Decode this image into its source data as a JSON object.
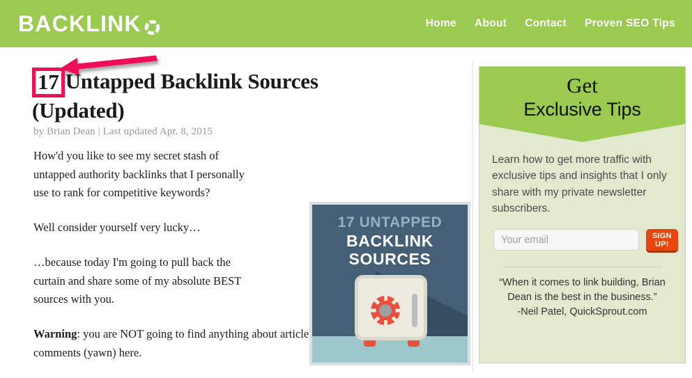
{
  "header": {
    "logo_text": "BACKLINK",
    "logo_icon": "dashed-circle-o",
    "nav": [
      {
        "label": "Home"
      },
      {
        "label": "About"
      },
      {
        "label": "Contact"
      },
      {
        "label": "Proven SEO Tips"
      }
    ],
    "background_color": "#9ACA4F"
  },
  "annotation": {
    "arrow_color": "#EE1158",
    "highlight_box_color": "#EE1158",
    "highlight_target": "17"
  },
  "article": {
    "title_badge": "17",
    "title_rest": "Untapped Backlink Sources (Updated)",
    "meta": "by Brian Dean | Last updated Apr. 8, 2015",
    "paragraphs": [
      "How'd you like to see my secret stash of untapped authority backlinks that I personally use to rank for competitive keywords?",
      "Well consider yourself very lucky…",
      "…because today I'm going to pull back the curtain and share some of my absolute BEST sources with you."
    ],
    "warning_label": "Warning",
    "warning_text": ": you are NOT going to find anything about article directories (blah) or blog comments (yawn) here."
  },
  "featured_image": {
    "line1": "17 UNTAPPED",
    "line2a": "BACKLINK",
    "line2b": "SOURCES",
    "background_color": "#456076",
    "accent_color": "#8FB6BE",
    "floor_color": "#9CC7CB",
    "safe_color": "#EDEAE0",
    "dial_color": "#E8503C"
  },
  "sidebar": {
    "title_line1": "Get",
    "title_line2": "Exclusive Tips",
    "description": "Learn how to get more traffic with exclusive tips and insights that I only share with my private newsletter subscribers.",
    "email_placeholder": "Your email",
    "email_value": "",
    "signup_label": "SIGN UP!",
    "testimonial_line1": "“When it comes to link building, Brian",
    "testimonial_line2": "Dean is the best in the business.”",
    "testimonial_line3": "-Neil Patel, QuickSprout.com",
    "header_color": "#9ACA4F",
    "body_color": "#E3E9CF",
    "button_color": "#E8450E"
  }
}
